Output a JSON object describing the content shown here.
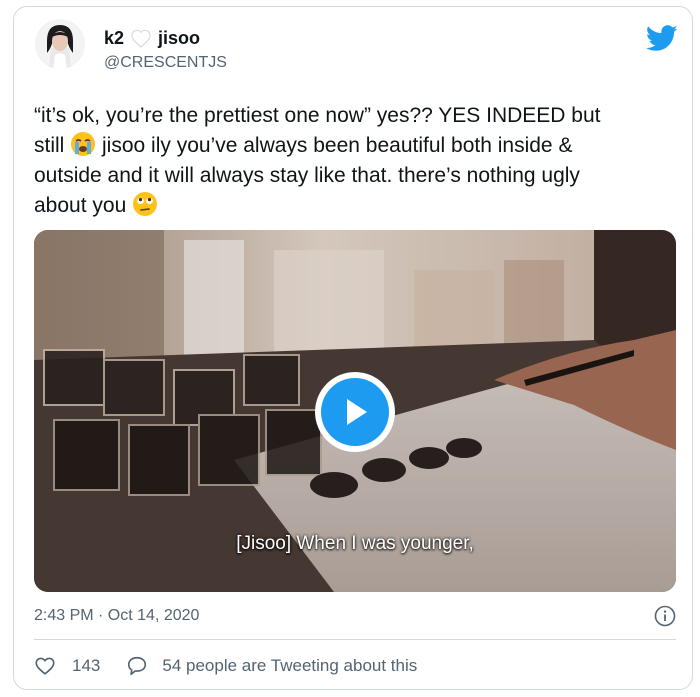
{
  "author": {
    "name_part1": "k2",
    "name_part2": "jisoo",
    "handle": "@CRESCENTJS"
  },
  "tweet": {
    "text_1": "“it’s ok, you’re the prettiest one now” yes?? YES INDEED but\nstill ",
    "text_2": " jisoo ily you’ve always been beautiful both inside &\noutside and it will always stay like that. there’s nothing ugly\nabout you ",
    "emoji_1": "loudly-crying-face",
    "emoji_2": "face-with-rolling-eyes"
  },
  "media": {
    "subtitle": "[Jisoo] When I was younger,",
    "play_icon": "play-icon"
  },
  "meta": {
    "timestamp": "2:43 PM · Oct 14, 2020"
  },
  "actions": {
    "like_count": "143",
    "reply_text": "54 people are Tweeting about this"
  },
  "colors": {
    "accent": "#1d9bf0",
    "text": "#0f1419",
    "muted": "#536471",
    "border": "#cfd9de"
  }
}
